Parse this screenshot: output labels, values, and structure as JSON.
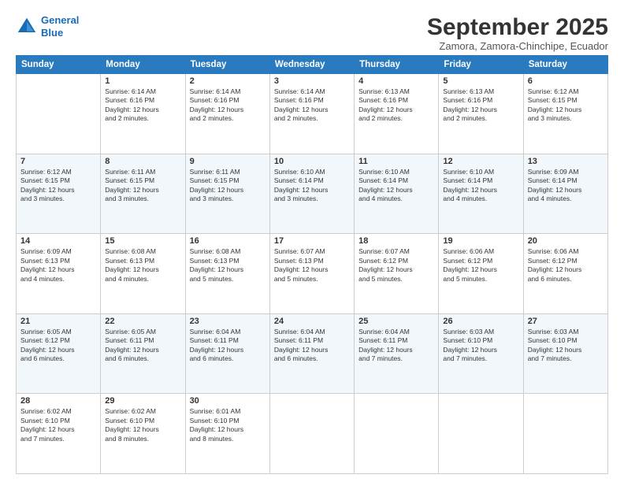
{
  "logo": {
    "line1": "General",
    "line2": "Blue"
  },
  "title": "September 2025",
  "subtitle": "Zamora, Zamora-Chinchipe, Ecuador",
  "headers": [
    "Sunday",
    "Monday",
    "Tuesday",
    "Wednesday",
    "Thursday",
    "Friday",
    "Saturday"
  ],
  "weeks": [
    [
      {
        "day": "",
        "info": ""
      },
      {
        "day": "1",
        "info": "Sunrise: 6:14 AM\nSunset: 6:16 PM\nDaylight: 12 hours\nand 2 minutes."
      },
      {
        "day": "2",
        "info": "Sunrise: 6:14 AM\nSunset: 6:16 PM\nDaylight: 12 hours\nand 2 minutes."
      },
      {
        "day": "3",
        "info": "Sunrise: 6:14 AM\nSunset: 6:16 PM\nDaylight: 12 hours\nand 2 minutes."
      },
      {
        "day": "4",
        "info": "Sunrise: 6:13 AM\nSunset: 6:16 PM\nDaylight: 12 hours\nand 2 minutes."
      },
      {
        "day": "5",
        "info": "Sunrise: 6:13 AM\nSunset: 6:16 PM\nDaylight: 12 hours\nand 2 minutes."
      },
      {
        "day": "6",
        "info": "Sunrise: 6:12 AM\nSunset: 6:15 PM\nDaylight: 12 hours\nand 3 minutes."
      }
    ],
    [
      {
        "day": "7",
        "info": "Sunrise: 6:12 AM\nSunset: 6:15 PM\nDaylight: 12 hours\nand 3 minutes."
      },
      {
        "day": "8",
        "info": "Sunrise: 6:11 AM\nSunset: 6:15 PM\nDaylight: 12 hours\nand 3 minutes."
      },
      {
        "day": "9",
        "info": "Sunrise: 6:11 AM\nSunset: 6:15 PM\nDaylight: 12 hours\nand 3 minutes."
      },
      {
        "day": "10",
        "info": "Sunrise: 6:10 AM\nSunset: 6:14 PM\nDaylight: 12 hours\nand 3 minutes."
      },
      {
        "day": "11",
        "info": "Sunrise: 6:10 AM\nSunset: 6:14 PM\nDaylight: 12 hours\nand 4 minutes."
      },
      {
        "day": "12",
        "info": "Sunrise: 6:10 AM\nSunset: 6:14 PM\nDaylight: 12 hours\nand 4 minutes."
      },
      {
        "day": "13",
        "info": "Sunrise: 6:09 AM\nSunset: 6:14 PM\nDaylight: 12 hours\nand 4 minutes."
      }
    ],
    [
      {
        "day": "14",
        "info": "Sunrise: 6:09 AM\nSunset: 6:13 PM\nDaylight: 12 hours\nand 4 minutes."
      },
      {
        "day": "15",
        "info": "Sunrise: 6:08 AM\nSunset: 6:13 PM\nDaylight: 12 hours\nand 4 minutes."
      },
      {
        "day": "16",
        "info": "Sunrise: 6:08 AM\nSunset: 6:13 PM\nDaylight: 12 hours\nand 5 minutes."
      },
      {
        "day": "17",
        "info": "Sunrise: 6:07 AM\nSunset: 6:13 PM\nDaylight: 12 hours\nand 5 minutes."
      },
      {
        "day": "18",
        "info": "Sunrise: 6:07 AM\nSunset: 6:12 PM\nDaylight: 12 hours\nand 5 minutes."
      },
      {
        "day": "19",
        "info": "Sunrise: 6:06 AM\nSunset: 6:12 PM\nDaylight: 12 hours\nand 5 minutes."
      },
      {
        "day": "20",
        "info": "Sunrise: 6:06 AM\nSunset: 6:12 PM\nDaylight: 12 hours\nand 6 minutes."
      }
    ],
    [
      {
        "day": "21",
        "info": "Sunrise: 6:05 AM\nSunset: 6:12 PM\nDaylight: 12 hours\nand 6 minutes."
      },
      {
        "day": "22",
        "info": "Sunrise: 6:05 AM\nSunset: 6:11 PM\nDaylight: 12 hours\nand 6 minutes."
      },
      {
        "day": "23",
        "info": "Sunrise: 6:04 AM\nSunset: 6:11 PM\nDaylight: 12 hours\nand 6 minutes."
      },
      {
        "day": "24",
        "info": "Sunrise: 6:04 AM\nSunset: 6:11 PM\nDaylight: 12 hours\nand 6 minutes."
      },
      {
        "day": "25",
        "info": "Sunrise: 6:04 AM\nSunset: 6:11 PM\nDaylight: 12 hours\nand 7 minutes."
      },
      {
        "day": "26",
        "info": "Sunrise: 6:03 AM\nSunset: 6:10 PM\nDaylight: 12 hours\nand 7 minutes."
      },
      {
        "day": "27",
        "info": "Sunrise: 6:03 AM\nSunset: 6:10 PM\nDaylight: 12 hours\nand 7 minutes."
      }
    ],
    [
      {
        "day": "28",
        "info": "Sunrise: 6:02 AM\nSunset: 6:10 PM\nDaylight: 12 hours\nand 7 minutes."
      },
      {
        "day": "29",
        "info": "Sunrise: 6:02 AM\nSunset: 6:10 PM\nDaylight: 12 hours\nand 8 minutes."
      },
      {
        "day": "30",
        "info": "Sunrise: 6:01 AM\nSunset: 6:10 PM\nDaylight: 12 hours\nand 8 minutes."
      },
      {
        "day": "",
        "info": ""
      },
      {
        "day": "",
        "info": ""
      },
      {
        "day": "",
        "info": ""
      },
      {
        "day": "",
        "info": ""
      }
    ]
  ]
}
